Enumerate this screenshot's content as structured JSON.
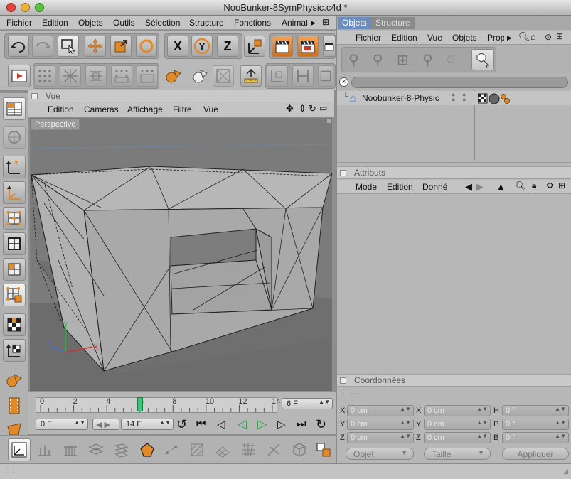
{
  "window": {
    "title": "NooBunker-8SymPhysic.c4d *"
  },
  "main_menu": [
    "Fichier",
    "Edition",
    "Objets",
    "Outils",
    "Sélection",
    "Structure",
    "Fonctions",
    "Animat"
  ],
  "viewport": {
    "header": "Vue",
    "menu": [
      "Edition",
      "Caméras",
      "Affichage",
      "Filtre",
      "Vue"
    ],
    "label": "Perspective",
    "axes": {
      "x": "X",
      "y": "Y",
      "z": "Z"
    }
  },
  "timeline": {
    "ticks": [
      "0",
      "2",
      "4",
      "6",
      "8",
      "10",
      "12",
      "14"
    ],
    "current_frame": 6,
    "max_frame": 14,
    "end_field": "6 F",
    "start_field": "0 F",
    "max_field": "14 F"
  },
  "objects_panel": {
    "tabs": [
      "Objets",
      "Structure"
    ],
    "menu": [
      "Fichier",
      "Edition",
      "Vue",
      "Objets",
      "Prop"
    ],
    "object_name": "Noobunker-8-Physic"
  },
  "attributes_panel": {
    "header": "Attributs",
    "menu": [
      "Mode",
      "Edition",
      "Donné"
    ]
  },
  "coords_panel": {
    "header": "Coordonnées",
    "col_headers": [
      "--",
      "--",
      "--"
    ],
    "rows": [
      {
        "l1": "X",
        "v1": "0 cm",
        "l2": "X",
        "v2": "0 cm",
        "l3": "H",
        "v3": "0 °"
      },
      {
        "l1": "Y",
        "v1": "0 cm",
        "l2": "Y",
        "v2": "0 cm",
        "l3": "P",
        "v3": "0 °"
      },
      {
        "l1": "Z",
        "v1": "0 cm",
        "l2": "Z",
        "v2": "0 cm",
        "l3": "B",
        "v3": "0 °"
      }
    ],
    "mode_dropdown": "Objet",
    "size_dropdown": "Taille",
    "apply_button": "Appliquer"
  },
  "colors": {
    "accent_orange": "#e08a2c",
    "keyframe_green": "#38c878",
    "tab_active": "#6c8ebf"
  }
}
